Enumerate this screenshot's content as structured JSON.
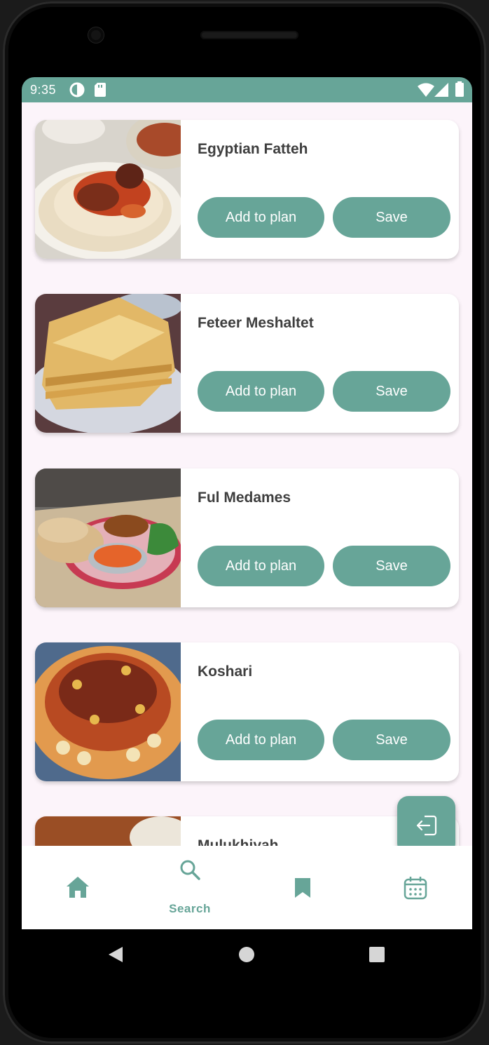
{
  "status": {
    "time": "9:35"
  },
  "meals": [
    {
      "title": "Egyptian Fatteh",
      "plan_label": "Add to plan",
      "save_label": "Save"
    },
    {
      "title": "Feteer Meshaltet",
      "plan_label": "Add to plan",
      "save_label": "Save"
    },
    {
      "title": "Ful Medames",
      "plan_label": "Add to plan",
      "save_label": "Save"
    },
    {
      "title": "Koshari",
      "plan_label": "Add to plan",
      "save_label": "Save"
    },
    {
      "title": "Mulukhiyah"
    }
  ],
  "nav": {
    "active": "Search",
    "search_label": "Search"
  },
  "colors": {
    "accent": "#67a598",
    "background": "#fcf4fa"
  },
  "icons": [
    "home-icon",
    "search-icon",
    "bookmark-icon",
    "calendar-icon",
    "logout-icon"
  ]
}
